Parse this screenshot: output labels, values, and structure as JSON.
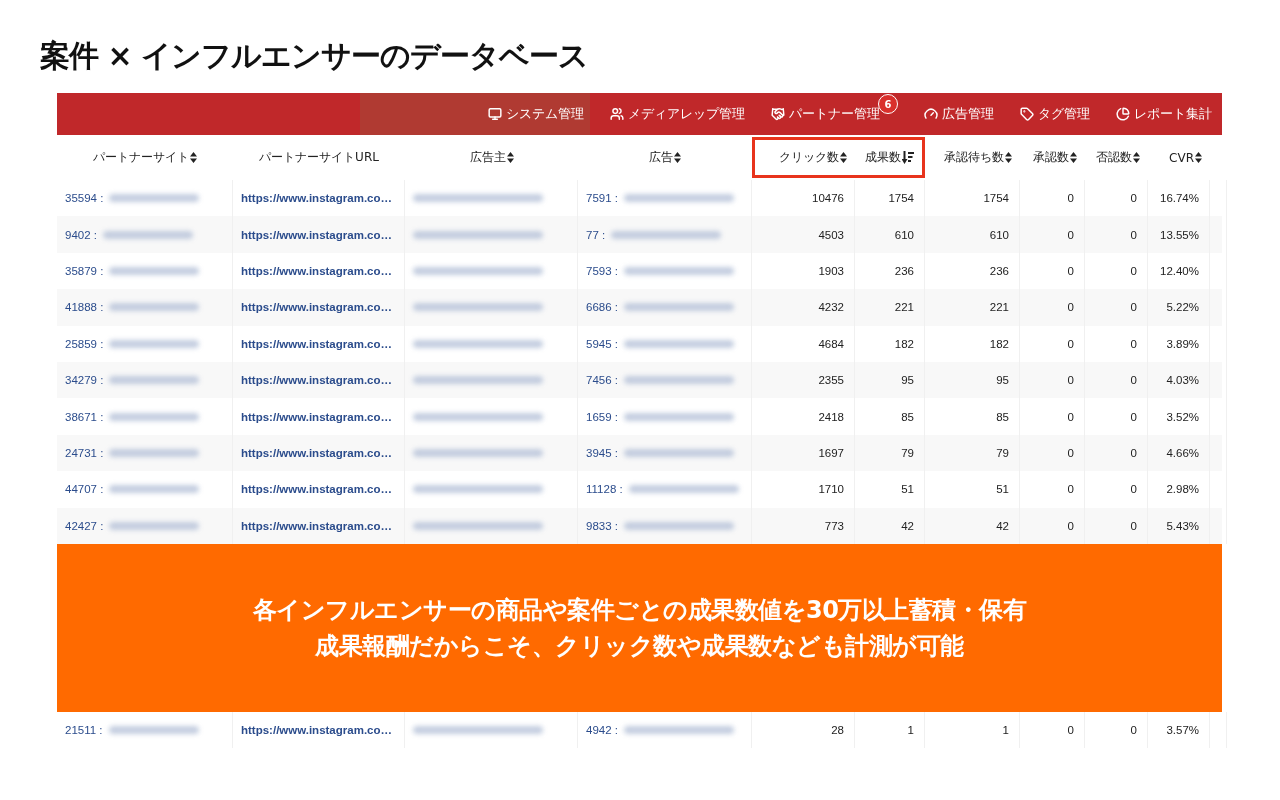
{
  "title": "案件 × インフルエンサーのデータベース",
  "nav": [
    {
      "kind": "monitor",
      "label": "システム管理"
    },
    {
      "kind": "users",
      "label": "メディアレップ管理"
    },
    {
      "kind": "handshake",
      "label": "パートナー管理",
      "badge": "6"
    },
    {
      "kind": "gauge",
      "label": "広告管理"
    },
    {
      "kind": "tag",
      "label": "タグ管理"
    },
    {
      "kind": "pie",
      "label": "レポート集計"
    }
  ],
  "columns": [
    {
      "label": "パートナーサイト",
      "kind": "text",
      "sortable": true,
      "sorted": false,
      "highlighted": false
    },
    {
      "label": "パートナーサイトURL",
      "kind": "text",
      "sortable": false,
      "highlighted": false
    },
    {
      "label": "広告主",
      "kind": "text",
      "sortable": true,
      "sorted": false,
      "highlighted": false
    },
    {
      "label": "広告",
      "kind": "text",
      "sortable": true,
      "sorted": false,
      "highlighted": false
    },
    {
      "label": "クリック数",
      "kind": "number",
      "sortable": true,
      "sorted": false,
      "highlighted": true
    },
    {
      "label": "成果数",
      "kind": "number",
      "sortable": true,
      "sorted": true,
      "highlighted": true
    },
    {
      "label": "承認待ち数",
      "kind": "number",
      "sortable": true,
      "sorted": false,
      "highlighted": false
    },
    {
      "label": "承認数",
      "kind": "number",
      "sortable": true,
      "sorted": false,
      "highlighted": false
    },
    {
      "label": "否認数",
      "kind": "number",
      "sortable": true,
      "sorted": false,
      "highlighted": false
    },
    {
      "label": "CVR",
      "kind": "number",
      "sortable": true,
      "sorted": false,
      "highlighted": false
    }
  ],
  "rows": [
    {
      "site": "35594 :",
      "url": "https://www.instagram.co…",
      "ad": "7591 :",
      "clicks": "10476",
      "results": "1754",
      "pending": "1754",
      "approved": "0",
      "rejected": "0",
      "cvr": "16.74%"
    },
    {
      "site": "9402 :",
      "url": "https://www.instagram.co…",
      "ad": "77 :",
      "clicks": "4503",
      "results": "610",
      "pending": "610",
      "approved": "0",
      "rejected": "0",
      "cvr": "13.55%"
    },
    {
      "site": "35879 :",
      "url": "https://www.instagram.co…",
      "ad": "7593 :",
      "clicks": "1903",
      "results": "236",
      "pending": "236",
      "approved": "0",
      "rejected": "0",
      "cvr": "12.40%"
    },
    {
      "site": "41888 :",
      "url": "https://www.instagram.co…",
      "ad": "6686 :",
      "clicks": "4232",
      "results": "221",
      "pending": "221",
      "approved": "0",
      "rejected": "0",
      "cvr": "5.22%"
    },
    {
      "site": "25859 :",
      "url": "https://www.instagram.co…",
      "ad": "5945 :",
      "clicks": "4684",
      "results": "182",
      "pending": "182",
      "approved": "0",
      "rejected": "0",
      "cvr": "3.89%"
    },
    {
      "site": "34279 :",
      "url": "https://www.instagram.co…",
      "ad": "7456 :",
      "clicks": "2355",
      "results": "95",
      "pending": "95",
      "approved": "0",
      "rejected": "0",
      "cvr": "4.03%"
    },
    {
      "site": "38671 :",
      "url": "https://www.instagram.co…",
      "ad": "1659 :",
      "clicks": "2418",
      "results": "85",
      "pending": "85",
      "approved": "0",
      "rejected": "0",
      "cvr": "3.52%"
    },
    {
      "site": "24731 :",
      "url": "https://www.instagram.co…",
      "ad": "3945 :",
      "clicks": "1697",
      "results": "79",
      "pending": "79",
      "approved": "0",
      "rejected": "0",
      "cvr": "4.66%"
    },
    {
      "site": "44707 :",
      "url": "https://www.instagram.co…",
      "ad": "11128 :",
      "clicks": "1710",
      "results": "51",
      "pending": "51",
      "approved": "0",
      "rejected": "0",
      "cvr": "2.98%"
    },
    {
      "site": "42427 :",
      "url": "https://www.instagram.co…",
      "ad": "9833 :",
      "clicks": "773",
      "results": "42",
      "pending": "42",
      "approved": "0",
      "rejected": "0",
      "cvr": "5.43%"
    }
  ],
  "banner": {
    "lines": [
      "各インフルエンサーの商品や案件ごとの成果数値を30万以上蓄積・保有",
      "成果報酬だからこそ、クリック数や成果数なども計測が可能"
    ]
  },
  "last_row": {
    "site": "21511 :",
    "url": "https://www.instagram.co…",
    "ad": "4942 :",
    "clicks": "28",
    "results": "1",
    "pending": "1",
    "approved": "0",
    "rejected": "0",
    "cvr": "3.57%"
  }
}
